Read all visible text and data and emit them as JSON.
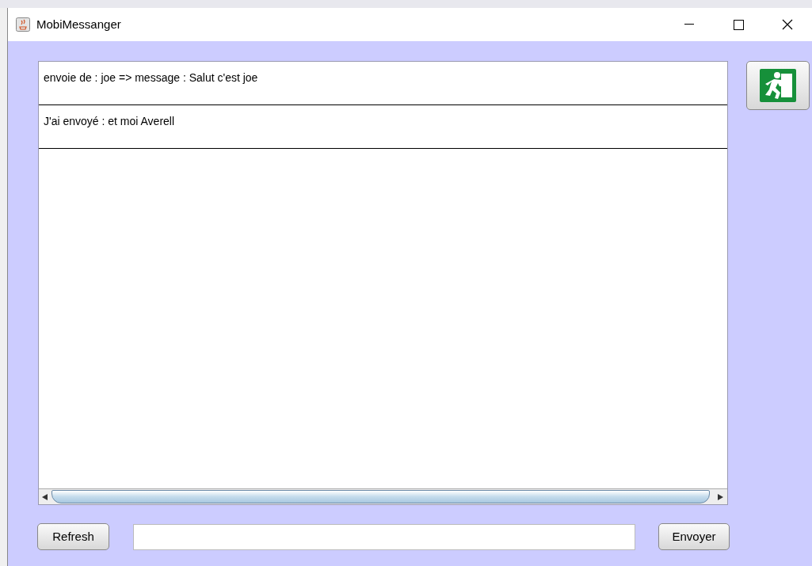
{
  "window": {
    "title": "MobiMessanger"
  },
  "messages": [
    {
      "text": "envoie de : joe => message : Salut c'est joe"
    },
    {
      "text": "J'ai envoyé : et moi Averell"
    }
  ],
  "buttons": {
    "refresh": "Refresh",
    "send": "Envoyer"
  }
}
